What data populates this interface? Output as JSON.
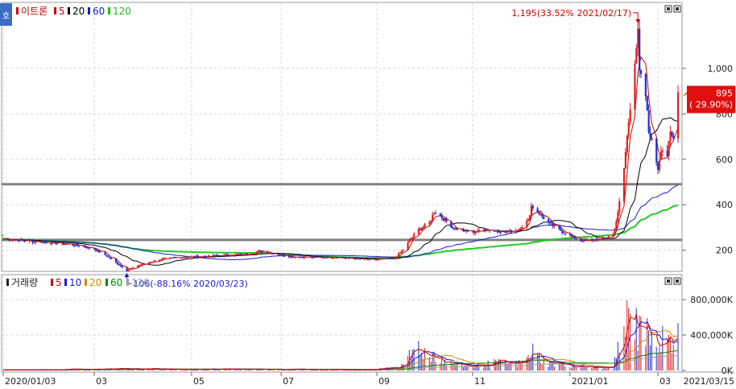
{
  "window": {
    "mode_icon_label": "호",
    "price_legend": [
      {
        "label": "이트론",
        "color": "#d00000"
      },
      {
        "label": "5",
        "color": "#d00000"
      },
      {
        "label": "20",
        "color": "#000000"
      },
      {
        "label": "60",
        "color": "#1a1ad0"
      },
      {
        "label": "120",
        "color": "#22bb22"
      }
    ],
    "volume_legend": [
      {
        "label": "거래량",
        "color": "#222222"
      },
      {
        "label": "5",
        "color": "#d00000"
      },
      {
        "label": "10",
        "color": "#1a1ad0"
      },
      {
        "label": "20",
        "color": "#d08a00"
      },
      {
        "label": "60",
        "color": "#008800"
      },
      {
        "label": "120",
        "color": "#a0a0a0"
      }
    ],
    "colors": {
      "up": "#e02020",
      "down": "#2030d0",
      "ma5": "#d00000",
      "ma20": "#000000",
      "ma60": "#1a1ad0",
      "ma120": "#22cc22",
      "hline": "#808080"
    }
  },
  "chart_data": [
    {
      "type": "candlestick",
      "name": "이트론",
      "ylim": [
        110,
        1230
      ],
      "y_ticks": [
        {
          "value": 200,
          "label": "200"
        },
        {
          "value": 400,
          "label": "400"
        },
        {
          "value": 600,
          "label": "600"
        },
        {
          "value": 800,
          "label": "800"
        },
        {
          "value": 1000,
          "label": "1,000"
        }
      ],
      "x_ticks": [
        {
          "label": "2020/01/03",
          "date": "2020-01-03"
        },
        {
          "label": "03",
          "date": "2020-03-02"
        },
        {
          "label": "05",
          "date": "2020-05-04"
        },
        {
          "label": "07",
          "date": "2020-07-01"
        },
        {
          "label": "09",
          "date": "2020-09-01"
        },
        {
          "label": "11",
          "date": "2020-11-02"
        },
        {
          "label": "2021/01",
          "date": "2021-01-04"
        },
        {
          "label": "03",
          "date": "2021-03-02"
        },
        {
          "label": "2021/03/15",
          "date": "2021-03-15"
        }
      ],
      "horizontal_lines": [
        490,
        245
      ],
      "close_points": [
        [
          "2020-01-03",
          250
        ],
        [
          "2020-01-20",
          240
        ],
        [
          "2020-02-05",
          232
        ],
        [
          "2020-02-20",
          222
        ],
        [
          "2020-03-02",
          205
        ],
        [
          "2020-03-10",
          175
        ],
        [
          "2020-03-17",
          140
        ],
        [
          "2020-03-23",
          110
        ],
        [
          "2020-03-31",
          135
        ],
        [
          "2020-04-14",
          160
        ],
        [
          "2020-04-28",
          170
        ],
        [
          "2020-05-12",
          172
        ],
        [
          "2020-05-26",
          178
        ],
        [
          "2020-06-09",
          182
        ],
        [
          "2020-06-16",
          196
        ],
        [
          "2020-06-23",
          190
        ],
        [
          "2020-07-07",
          172
        ],
        [
          "2020-07-21",
          168
        ],
        [
          "2020-08-04",
          170
        ],
        [
          "2020-08-18",
          162
        ],
        [
          "2020-08-28",
          158
        ],
        [
          "2020-09-08",
          162
        ],
        [
          "2020-09-14",
          175
        ],
        [
          "2020-09-18",
          200
        ],
        [
          "2020-09-23",
          250
        ],
        [
          "2020-09-28",
          290
        ],
        [
          "2020-10-05",
          320
        ],
        [
          "2020-10-08",
          370
        ],
        [
          "2020-10-13",
          345
        ],
        [
          "2020-10-20",
          300
        ],
        [
          "2020-10-27",
          285
        ],
        [
          "2020-11-03",
          280
        ],
        [
          "2020-11-10",
          292
        ],
        [
          "2020-11-17",
          285
        ],
        [
          "2020-11-24",
          280
        ],
        [
          "2020-12-01",
          290
        ],
        [
          "2020-12-08",
          330
        ],
        [
          "2020-12-10",
          395
        ],
        [
          "2020-12-14",
          370
        ],
        [
          "2020-12-21",
          320
        ],
        [
          "2020-12-28",
          290
        ],
        [
          "2021-01-05",
          260
        ],
        [
          "2021-01-12",
          240
        ],
        [
          "2021-01-19",
          245
        ],
        [
          "2021-01-26",
          252
        ],
        [
          "2021-02-01",
          270
        ],
        [
          "2021-02-04",
          360
        ],
        [
          "2021-02-08",
          560
        ],
        [
          "2021-02-10",
          700
        ],
        [
          "2021-02-15",
          1040
        ],
        [
          "2021-02-17",
          1150
        ],
        [
          "2021-02-18",
          980
        ],
        [
          "2021-02-22",
          880
        ],
        [
          "2021-02-24",
          720
        ],
        [
          "2021-02-26",
          680
        ],
        [
          "2021-03-02",
          560
        ],
        [
          "2021-03-04",
          650
        ],
        [
          "2021-03-08",
          620
        ],
        [
          "2021-03-10",
          710
        ],
        [
          "2021-03-12",
          690
        ],
        [
          "2021-03-15",
          895
        ]
      ],
      "moving_averages": [
        {
          "name": "5",
          "color": "#d00000"
        },
        {
          "name": "20",
          "color": "#000000"
        },
        {
          "name": "60",
          "color": "#1a1ad0"
        },
        {
          "name": "120",
          "color": "#22cc22"
        }
      ],
      "annotations": {
        "high": {
          "value": 1195,
          "date": "2021-02-17",
          "label": "1,195(33.52% 2021/02/17)"
        },
        "low": {
          "value": 106,
          "date": "2020-03-23",
          "label": "106(-88.16% 2020/03/23)"
        }
      },
      "last_price": {
        "value": 895,
        "label": "895",
        "change_label": "( 29.90%)"
      }
    },
    {
      "type": "bar",
      "name": "거래량",
      "ylim": [
        0,
        1000000
      ],
      "y_ticks": [
        {
          "value": 0,
          "label": "0K"
        },
        {
          "value": 400000,
          "label": "400,000K"
        },
        {
          "value": 800000,
          "label": "800,000K"
        }
      ],
      "volume_points": [
        [
          "2020-01-03",
          6000
        ],
        [
          "2020-03-23",
          22000
        ],
        [
          "2020-06-16",
          18000
        ],
        [
          "2020-08-28",
          9000
        ],
        [
          "2020-09-18",
          60000
        ],
        [
          "2020-09-23",
          240000
        ],
        [
          "2020-09-28",
          360000
        ],
        [
          "2020-10-05",
          180000
        ],
        [
          "2020-10-08",
          260000
        ],
        [
          "2020-10-13",
          150000
        ],
        [
          "2020-10-20",
          90000
        ],
        [
          "2020-11-03",
          60000
        ],
        [
          "2020-11-17",
          110000
        ],
        [
          "2020-12-01",
          90000
        ],
        [
          "2020-12-08",
          170000
        ],
        [
          "2020-12-10",
          290000
        ],
        [
          "2020-12-14",
          200000
        ],
        [
          "2020-12-21",
          110000
        ],
        [
          "2021-01-05",
          70000
        ],
        [
          "2021-01-19",
          40000
        ],
        [
          "2021-02-01",
          40000
        ],
        [
          "2021-02-04",
          280000
        ],
        [
          "2021-02-08",
          520000
        ],
        [
          "2021-02-10",
          700000
        ],
        [
          "2021-02-15",
          760000
        ],
        [
          "2021-02-17",
          500000
        ],
        [
          "2021-02-18",
          910000
        ],
        [
          "2021-02-22",
          560000
        ],
        [
          "2021-02-24",
          430000
        ],
        [
          "2021-02-26",
          880000
        ],
        [
          "2021-03-02",
          350000
        ],
        [
          "2021-03-04",
          460000
        ],
        [
          "2021-03-08",
          300000
        ],
        [
          "2021-03-10",
          480000
        ],
        [
          "2021-03-12",
          360000
        ],
        [
          "2021-03-15",
          870000
        ]
      ]
    }
  ]
}
